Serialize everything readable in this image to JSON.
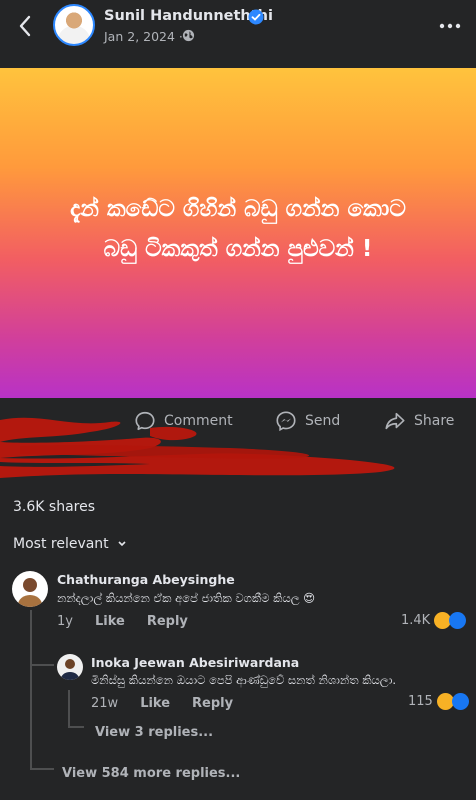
{
  "header": {
    "author": "Sunil Handunneththi",
    "date": "Jan 2, 2024 ·"
  },
  "post": {
    "line1": "දැන් කඩේට ගිහින් බඩු ගන්න කොට",
    "line2": "බඩු ටිකකුත් ගන්න පුළුවන් !"
  },
  "actions": {
    "comment": "Comment",
    "send": "Send",
    "share": "Share"
  },
  "stats": {
    "shares": "3.6K shares",
    "sort": "Most relevant"
  },
  "comments": [
    {
      "author": "Chathuranga Abeysinghe",
      "text": "නන්දලාල් කියන්නෙ ඒක අපේ ජාතික වගකීම කියල 😍",
      "age": "1y",
      "like": "Like",
      "reply": "Reply",
      "reactions": "1.4K"
    }
  ],
  "reply": {
    "author": "Inoka Jeewan Abesiriwardana",
    "text": "මිනිස්සු කියන්නෙ ඔයාට පෙපි ආණ්ඩුවේ සනත් නිශාන්ත කියලා.",
    "age": "21w",
    "like": "Like",
    "reply": "Reply",
    "reactions": "115",
    "view_replies": "View 3 replies..."
  },
  "more_replies": "View 584 more replies...",
  "colors": {
    "background": "#242526",
    "verified": "#2d88ff",
    "like": "#1877f2",
    "haha": "#f7b125",
    "redaction": "#c0170c"
  }
}
